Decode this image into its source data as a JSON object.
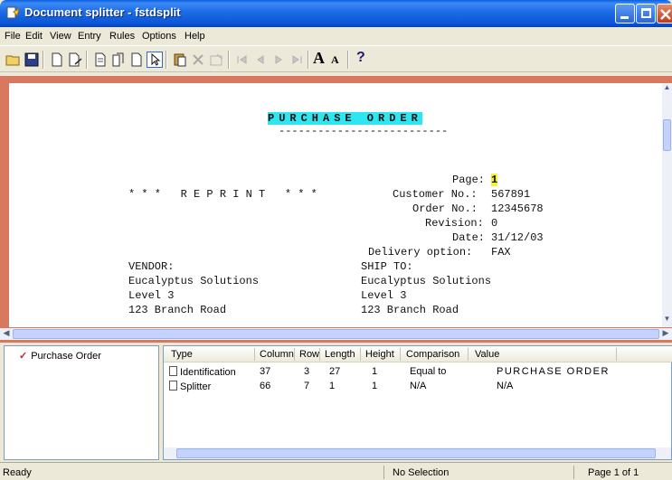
{
  "window": {
    "title": "Document splitter - fstdsplit"
  },
  "menu": [
    "File",
    "Edit",
    "View",
    "Entry",
    "Rules",
    "Options",
    "Help"
  ],
  "toolbar": {
    "icons": [
      "open-folder-icon",
      "save-icon",
      "new-document-icon",
      "document-zoom-icon",
      "page-icon",
      "copy-page-icon",
      "page-blank-icon",
      "pointer-icon",
      "paste-icon",
      "delete-icon",
      "properties-icon",
      "first-icon",
      "previous-icon",
      "next-icon",
      "last-icon",
      "font-larger-icon",
      "font-smaller-icon",
      "help-icon"
    ],
    "font_large_label": "A",
    "font_small_label": "A",
    "help_label": "?"
  },
  "document": {
    "heading": "PURCHASE ORDER",
    "heading_underline": "--------------------------",
    "reprint": "* * *   R E P R I N T   * * *",
    "fields": [
      {
        "label": "Page:",
        "value": "1"
      },
      {
        "label": "Customer No.:",
        "value": "567891"
      },
      {
        "label": "Order No.:",
        "value": "12345678"
      },
      {
        "label": "Revision:",
        "value": "0"
      },
      {
        "label": "Date:",
        "value": "31/12/03"
      },
      {
        "label": "Delivery option:",
        "value": "FAX"
      }
    ],
    "vendor": [
      "VENDOR:",
      "Eucalyptus Solutions",
      "Level 3",
      "123 Branch Road"
    ],
    "ship_to": [
      "SHIP TO:",
      "Eucalyptus Solutions",
      "Level 3",
      "123 Branch Road"
    ]
  },
  "tree": {
    "items": [
      {
        "label": "Purchase Order",
        "checked": true
      }
    ]
  },
  "rules_table": {
    "columns": [
      "Type",
      "Column",
      "Row",
      "Length",
      "Height",
      "Comparison",
      "Value"
    ],
    "rows": [
      {
        "type": "Identification",
        "column": "37",
        "row": "3",
        "length": "27",
        "height": "1",
        "comparison": "Equal to",
        "value": "PURCHASE ORDER"
      },
      {
        "type": "Splitter",
        "column": "66",
        "row": "7",
        "length": "1",
        "height": "1",
        "comparison": "N/A",
        "value": "N/A"
      }
    ]
  },
  "status": {
    "state": "Ready",
    "selection": "No Selection",
    "page": "Page 1 of 1"
  },
  "colors": {
    "titlebar": "#0a55d6",
    "doc_border": "#d8785e",
    "highlight_heading": "#2ee6ef",
    "highlight_page": "#f4f03c"
  }
}
